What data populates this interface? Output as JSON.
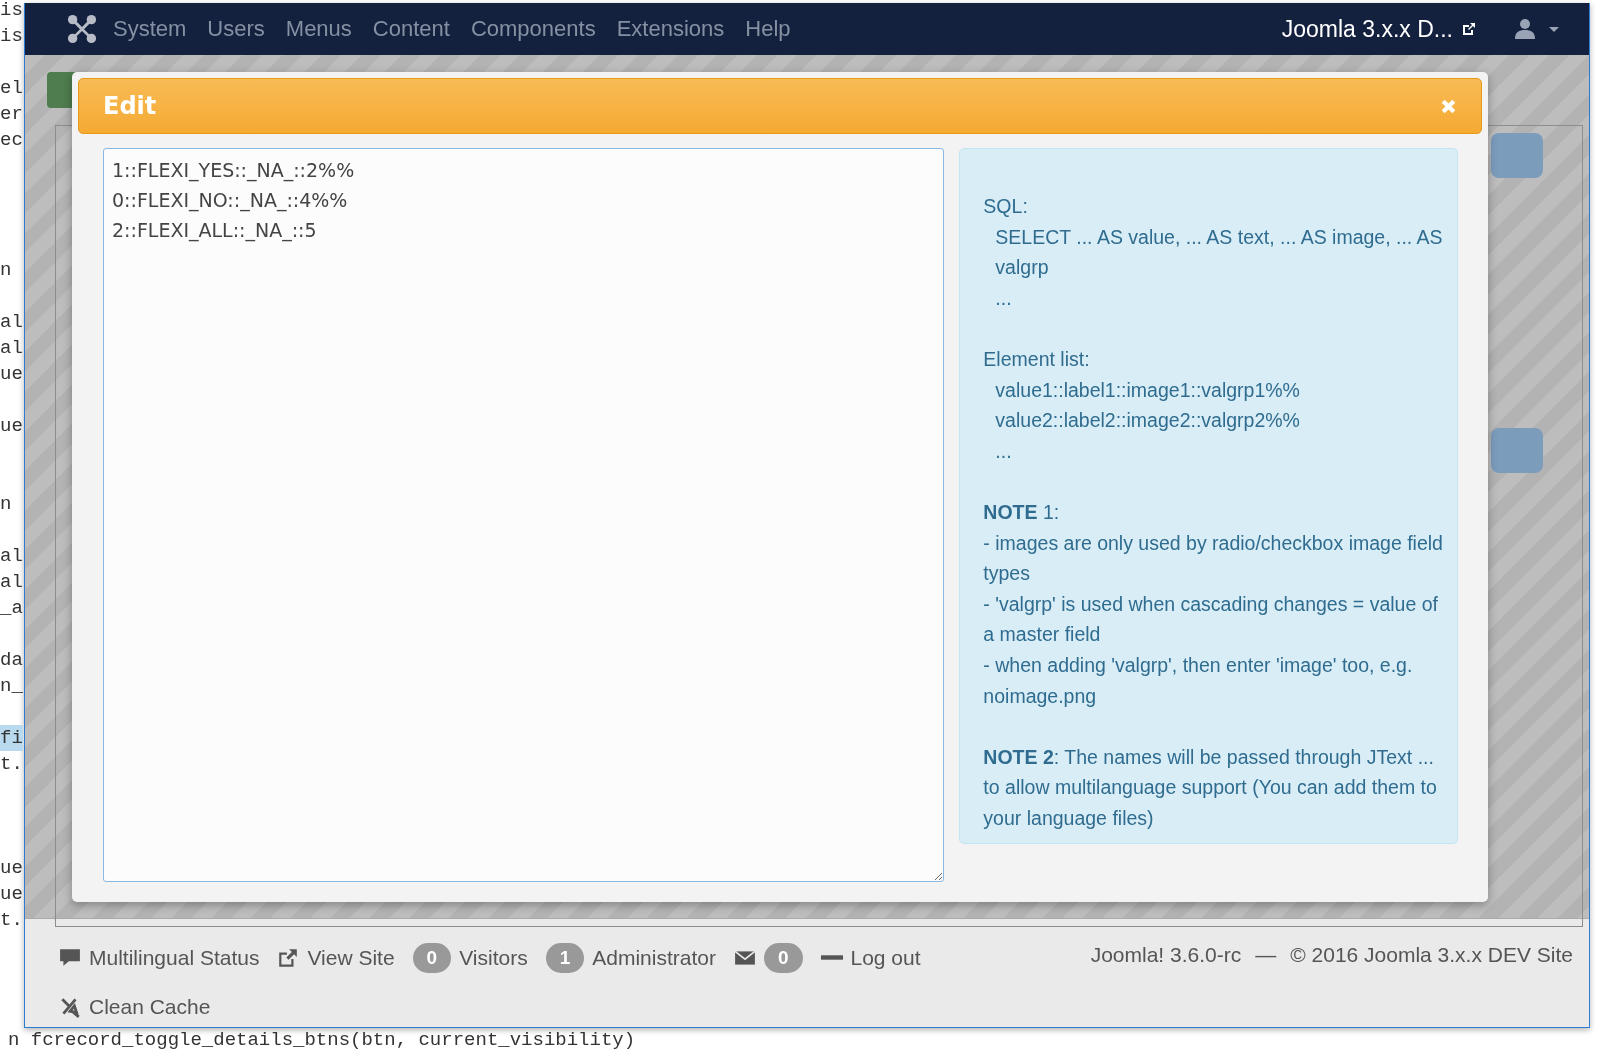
{
  "code_fragments": [
    {
      "text": "is",
      "selected": false
    },
    {
      "text": "is",
      "selected": false
    },
    {
      "text": "el",
      "selected": false
    },
    {
      "text": "er",
      "selected": false
    },
    {
      "text": "ec",
      "selected": false
    },
    {
      "text": "n",
      "selected": false
    },
    {
      "text": "al",
      "selected": false
    },
    {
      "text": "al",
      "selected": false
    },
    {
      "text": "ue",
      "selected": false
    },
    {
      "text": "ue",
      "selected": false
    },
    {
      "text": "n",
      "selected": false
    },
    {
      "text": "al",
      "selected": false
    },
    {
      "text": "al",
      "selected": false
    },
    {
      "text": "_a",
      "selected": false
    },
    {
      "text": "da",
      "selected": false
    },
    {
      "text": "n_",
      "selected": false
    },
    {
      "text": "fi",
      "selected": true
    },
    {
      "text": "t.",
      "selected": false
    },
    {
      "text": "ue",
      "selected": false
    },
    {
      "text": "ue",
      "selected": false
    },
    {
      "text": "t.",
      "selected": false
    }
  ],
  "navbar": {
    "menu": [
      "System",
      "Users",
      "Menus",
      "Content",
      "Components",
      "Extensions",
      "Help"
    ],
    "site_link": "Joomla 3.x.x D..."
  },
  "modal": {
    "title": "Edit",
    "editor_lines": [
      "1::FLEXI_YES::_NA_::2%%",
      "0::FLEXI_NO::_NA_::4%%",
      "2::FLEXI_ALL::_NA_::5"
    ],
    "help": [
      [
        {
          "text": "SQL:",
          "kind": "plain"
        },
        {
          "text": "SELECT ... AS value, ... AS text, ... AS image, ... AS valgrp",
          "kind": "indent"
        },
        {
          "text": "...",
          "kind": "indent"
        }
      ],
      [
        {
          "text": "Element list:",
          "kind": "plain"
        },
        {
          "text": "value1::label1::image1::valgrp1%%",
          "kind": "indent"
        },
        {
          "text": "value2::label2::image2::valgrp2%%",
          "kind": "indent"
        },
        {
          "text": "...",
          "kind": "indent"
        }
      ],
      [
        {
          "text": "**NOTE** 1:",
          "kind": "plain"
        },
        {
          "text": "- images are only used by radio/checkbox image field types",
          "kind": "plain"
        },
        {
          "text": "- 'valgrp' is used when cascading changes = value of a master field",
          "kind": "plain"
        },
        {
          "text": "- when adding 'valgrp', then enter 'image' too, e.g. noimage.png",
          "kind": "plain"
        }
      ],
      [
        {
          "text": "**NOTE 2**: The names will be passed through JText ... to allow multilanguage support (You can add them to your language files)",
          "kind": "plain"
        }
      ]
    ]
  },
  "footer": {
    "items": [
      {
        "kind": "icon-link",
        "label": "Multilingual Status"
      },
      {
        "kind": "icon-link",
        "label": "View Site"
      },
      {
        "kind": "badge-link",
        "badge": "0",
        "label": "Visitors"
      },
      {
        "kind": "badge-link",
        "badge": "1",
        "label": "Administrator"
      },
      {
        "kind": "icon-badge",
        "badge": "0"
      },
      {
        "kind": "icon-link",
        "label": "Log out"
      },
      {
        "kind": "icon-link",
        "label": "Clean Cache"
      }
    ],
    "version": "Joomla! 3.6.0-rc",
    "separator": "—",
    "copyright": "© 2016 Joomla 3.x.x DEV Site"
  },
  "bottom_code": "n fcrecord_toggle_details_btns(btn, current_visibility)"
}
